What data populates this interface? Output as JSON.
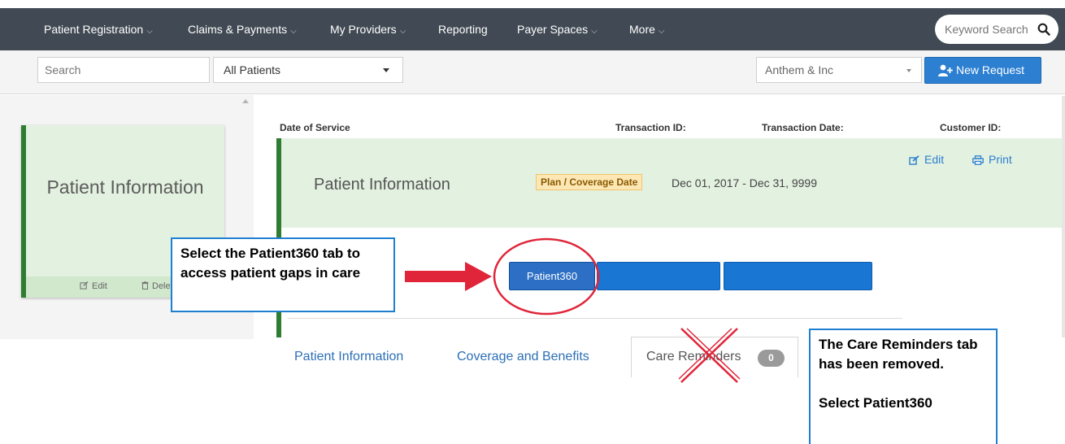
{
  "nav": {
    "items": [
      {
        "label": "Patient Registration",
        "has_menu": true
      },
      {
        "label": "Claims & Payments",
        "has_menu": true
      },
      {
        "label": "My Providers",
        "has_menu": true
      },
      {
        "label": "Reporting",
        "has_menu": false
      },
      {
        "label": "Payer Spaces",
        "has_menu": true
      },
      {
        "label": "More",
        "has_menu": true
      }
    ],
    "keyword_search_placeholder": "Keyword Search",
    "chevron": "⌵"
  },
  "toolbar": {
    "search_placeholder": "Search",
    "patient_filter": "All Patients",
    "payer": "Anthem & Inc",
    "new_request_label": "New Request"
  },
  "left_panel": {
    "card_title": "Patient Information",
    "edit_label": "Edit",
    "delete_label": "Delet"
  },
  "header": {
    "date_of_service": "Date of Service",
    "transaction_id": "Transaction ID:",
    "transaction_date": "Transaction Date:",
    "customer_id": "Customer ID:"
  },
  "info": {
    "title": "Patient Information",
    "plan_badge": "Plan / Coverage Date",
    "plan_dates": "Dec 01, 2017 - Dec 31, 9999",
    "edit_label": "Edit",
    "print_label": "Print"
  },
  "tabs": {
    "patient360": "Patient360"
  },
  "sub_tabs": {
    "patient_information": "Patient Information",
    "coverage_and_benefits": "Coverage and Benefits",
    "care_reminders": "Care Reminders",
    "care_reminders_count": "0"
  },
  "annotations": {
    "left": "Select the Patient360 tab to access patient gaps in care",
    "right_line1": "The Care Reminders tab has been removed.",
    "right_line2": "Select Patient360"
  },
  "colors": {
    "nav_bg": "#414a54",
    "accent_blue": "#1976d2",
    "panel_green": "#e3f1e0",
    "green_border": "#2f7d32",
    "annotation_red": "#e0253a",
    "callout_border": "#1f7fd1"
  }
}
